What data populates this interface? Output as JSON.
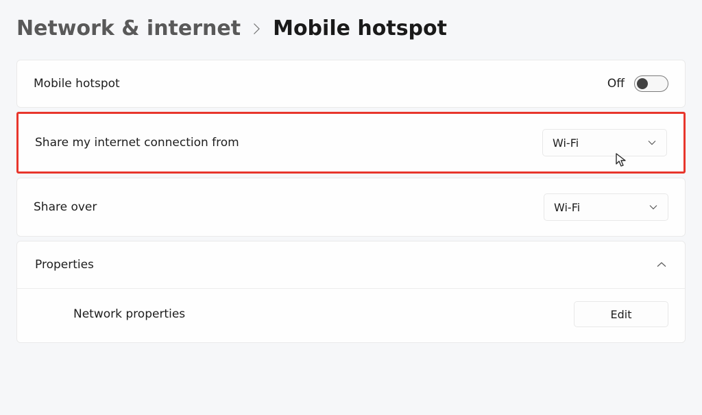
{
  "breadcrumb": {
    "parent": "Network & internet",
    "current": "Mobile hotspot"
  },
  "hotspot_toggle": {
    "label": "Mobile hotspot",
    "state_label": "Off"
  },
  "share_from": {
    "label": "Share my internet connection from",
    "selected": "Wi-Fi"
  },
  "share_over": {
    "label": "Share over",
    "selected": "Wi-Fi"
  },
  "properties": {
    "header_label": "Properties",
    "network_properties_label": "Network properties",
    "edit_label": "Edit"
  }
}
